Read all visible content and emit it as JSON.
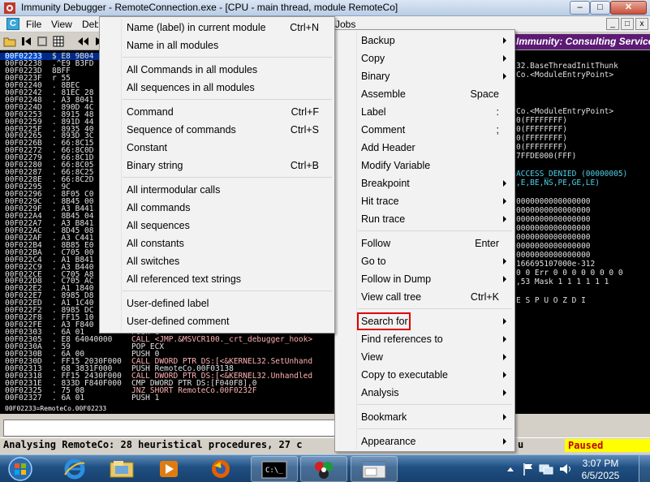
{
  "window": {
    "title": "Immunity Debugger - RemoteConnection.exe - [CPU - main thread, module RemoteCo]",
    "caption_min": "–",
    "caption_max": "□",
    "caption_close": "✕"
  },
  "menubar": {
    "icon_letter": "C",
    "items": [
      "File",
      "View",
      "Debug",
      "Jobs"
    ],
    "mdi_min": "_",
    "mdi_restore": "□",
    "mdi_close": "x"
  },
  "banner": "Immunity: Consulting Services Ma",
  "cpu": {
    "rows": [
      {
        "addr": "00F02233",
        "hex": "$ E8 9B04",
        "asm": "",
        "sel": true
      },
      {
        "addr": "00F02238",
        "hex": ".^E9 B3FD",
        "asm": ""
      },
      {
        "addr": "00F0223D",
        "hex": "  8BFF",
        "asm": ""
      },
      {
        "addr": "00F0223F",
        "hex": "r 55",
        "asm": ""
      },
      {
        "addr": "00F02240",
        "hex": ". 8BEC",
        "asm": ""
      },
      {
        "addr": "00F02242",
        "hex": ". 81EC 28",
        "asm": ""
      },
      {
        "addr": "00F02248",
        "hex": ". A3 8041",
        "asm": ""
      },
      {
        "addr": "00F0224D",
        "hex": ". 890D 4C",
        "asm": ""
      },
      {
        "addr": "00F02253",
        "hex": ". 8915 48",
        "asm": ""
      },
      {
        "addr": "00F02259",
        "hex": ". 891D 44",
        "asm": ""
      },
      {
        "addr": "00F0225F",
        "hex": ". 8935 40",
        "asm": ""
      },
      {
        "addr": "00F02265",
        "hex": ". 893D 3C",
        "asm": ""
      },
      {
        "addr": "00F0226B",
        "hex": ". 66:8C15",
        "asm": ""
      },
      {
        "addr": "00F02272",
        "hex": ". 66:8C0D",
        "asm": ""
      },
      {
        "addr": "00F02279",
        "hex": ". 66:8C1D",
        "asm": ""
      },
      {
        "addr": "00F02280",
        "hex": ". 66:8C05",
        "asm": ""
      },
      {
        "addr": "00F02287",
        "hex": ". 66:8C25",
        "asm": ""
      },
      {
        "addr": "00F0228E",
        "hex": ". 66:8C2D",
        "asm": ""
      },
      {
        "addr": "00F02295",
        "hex": ". 9C",
        "asm": ""
      },
      {
        "addr": "00F02296",
        "hex": ". 8F05 C0",
        "asm": ""
      },
      {
        "addr": "00F0229C",
        "hex": ". 8B45 00",
        "asm": ""
      },
      {
        "addr": "00F0229F",
        "hex": ". A3 B441",
        "asm": ""
      },
      {
        "addr": "00F022A4",
        "hex": ". 8B45 04",
        "asm": ""
      },
      {
        "addr": "00F022A7",
        "hex": ". A3 B841",
        "asm": ""
      },
      {
        "addr": "00F022AC",
        "hex": ". 8D45 08",
        "asm": ""
      },
      {
        "addr": "00F022AF",
        "hex": ". A3 C441",
        "asm": ""
      },
      {
        "addr": "00F022B4",
        "hex": ". 8B85 E0",
        "asm": ""
      },
      {
        "addr": "00F022BA",
        "hex": ". C705 00",
        "asm": ""
      },
      {
        "addr": "00F022C4",
        "hex": ". A1 B841",
        "asm": ""
      },
      {
        "addr": "00F022C9",
        "hex": ". A3 B440",
        "asm": ""
      },
      {
        "addr": "00F022CE",
        "hex": ". C705 A8",
        "asm": ""
      },
      {
        "addr": "00F022D8",
        "hex": ". C705 AC",
        "asm": ""
      },
      {
        "addr": "00F022E2",
        "hex": ". A1 1840",
        "asm": ""
      },
      {
        "addr": "00F022E7",
        "hex": ". 8985 D8",
        "asm": ""
      },
      {
        "addr": "00F022ED",
        "hex": ". A1 1C40",
        "asm": ""
      },
      {
        "addr": "00F022F2",
        "hex": ". 8985 DC",
        "asm": ""
      },
      {
        "addr": "00F022F8",
        "hex": ". FF15 10",
        "asm": ""
      },
      {
        "addr": "00F022FE",
        "hex": ". A3 F840",
        "asm": ""
      },
      {
        "addr": "00F02303",
        "hex": ". 6A 01",
        "asm": "PUSH 1"
      },
      {
        "addr": "00F02305",
        "hex": ". E8 64040000",
        "asm": "CALL <JMP.&MSVCR100._crt_debugger_hook>",
        "call": true
      },
      {
        "addr": "00F0230A",
        "hex": ". 59",
        "asm": "POP ECX"
      },
      {
        "addr": "00F0230B",
        "hex": ". 6A 00",
        "asm": "PUSH 0"
      },
      {
        "addr": "00F0230D",
        "hex": ". FF15 2030F000",
        "asm": "CALL DWORD PTR DS:[<&KERNEL32.SetUnhand",
        "call": true
      },
      {
        "addr": "00F02313",
        "hex": ". 68 3831F000",
        "asm": "PUSH RemoteCo.00F03138"
      },
      {
        "addr": "00F02318",
        "hex": ". FF15 2430F000",
        "asm": "CALL DWORD PTR DS:[<&KERNEL32.Unhandled",
        "call": true
      },
      {
        "addr": "00F0231E",
        "hex": ". 833D F840F000",
        "asm": "CMP DWORD PTR DS:[F040F8],0"
      },
      {
        "addr": "00F02325",
        "hex": ". 75 08",
        "asm": "JNZ SHORT RemoteCo.00F0232F",
        "jnz": true
      },
      {
        "addr": "00F02327",
        "hex": ". 6A 01",
        "asm": "PUSH 1"
      }
    ],
    "status_line": "00F02233=RemoteCo.00F02233"
  },
  "registers": [
    {
      "text": "32.BaseThreadInitThunk",
      "cyan": false
    },
    {
      "text": "Co.<ModuleEntryPoint>",
      "cyan": false
    },
    {
      "text": "",
      "cyan": false
    },
    {
      "text": "",
      "cyan": false
    },
    {
      "text": "",
      "cyan": false
    },
    {
      "text": "Co.<ModuleEntryPoint>",
      "cyan": false
    },
    {
      "text": "0(FFFFFFFF)",
      "cyan": false
    },
    {
      "text": "0(FFFFFFFF)",
      "cyan": false
    },
    {
      "text": "0(FFFFFFFF)",
      "cyan": false
    },
    {
      "text": "0(FFFFFFFF)",
      "cyan": false
    },
    {
      "text": "7FFDE000(FFF)",
      "cyan": false
    },
    {
      "text": "",
      "cyan": false
    },
    {
      "text": "ACCESS_DENIED (00000005)",
      "cyan": true
    },
    {
      "text": ",E,BE,NS,PE,GE,LE)",
      "cyan": true
    },
    {
      "text": "",
      "cyan": false
    },
    {
      "text": "0000000000000000",
      "cyan": false
    },
    {
      "text": "0000000000000000",
      "cyan": false
    },
    {
      "text": "0000000000000000",
      "cyan": false
    },
    {
      "text": "0000000000000000",
      "cyan": false
    },
    {
      "text": "0000000000000000",
      "cyan": false
    },
    {
      "text": "0000000000000000",
      "cyan": false
    },
    {
      "text": "0000000000000000",
      "cyan": false
    },
    {
      "text": "166695107000e-312",
      "cyan": false
    },
    {
      "text": "0 0  Err 0 0 0 0 0 0 0 0",
      "cyan": false
    },
    {
      "text": ",53  Mask   1 1 1 1 1 1",
      "cyan": false
    },
    {
      "text": "",
      "cyan": false
    },
    {
      "text": "E S P U O Z D I",
      "cyan": false
    }
  ],
  "statusbar": {
    "text": "Analysing RemoteCo: 28 heuristical procedures, 27 c",
    "tail": "u",
    "state": "Paused"
  },
  "menu_search": {
    "items": [
      {
        "label": "Name (label) in current module",
        "shortcut": "Ctrl+N"
      },
      {
        "label": "Name in all modules",
        "shortcut": ""
      },
      {
        "sep": true
      },
      {
        "label": "All Commands in all modules",
        "shortcut": ""
      },
      {
        "label": "All sequences in all modules",
        "shortcut": ""
      },
      {
        "sep": true
      },
      {
        "label": "Command",
        "shortcut": "Ctrl+F"
      },
      {
        "label": "Sequence of commands",
        "shortcut": "Ctrl+S"
      },
      {
        "label": "Constant",
        "shortcut": ""
      },
      {
        "label": "Binary string",
        "shortcut": "Ctrl+B"
      },
      {
        "sep": true
      },
      {
        "label": "All intermodular calls",
        "shortcut": ""
      },
      {
        "label": "All commands",
        "shortcut": ""
      },
      {
        "label": "All sequences",
        "shortcut": ""
      },
      {
        "label": "All constants",
        "shortcut": ""
      },
      {
        "label": "All switches",
        "shortcut": ""
      },
      {
        "label": "All referenced text strings",
        "shortcut": ""
      },
      {
        "sep": true
      },
      {
        "label": "User-defined label",
        "shortcut": ""
      },
      {
        "label": "User-defined comment",
        "shortcut": ""
      }
    ]
  },
  "menu_main": {
    "items": [
      {
        "label": "Backup",
        "shortcut": "",
        "sub": true
      },
      {
        "label": "Copy",
        "shortcut": "",
        "sub": true
      },
      {
        "label": "Binary",
        "shortcut": "",
        "sub": true
      },
      {
        "label": "Assemble",
        "shortcut": "Space",
        "sub": false
      },
      {
        "label": "Label",
        "shortcut": ":",
        "sub": false
      },
      {
        "label": "Comment",
        "shortcut": ";",
        "sub": false
      },
      {
        "label": "Add Header",
        "shortcut": "",
        "sub": false
      },
      {
        "label": "Modify Variable",
        "shortcut": "",
        "sub": false
      },
      {
        "label": "Breakpoint",
        "shortcut": "",
        "sub": true
      },
      {
        "label": "Hit trace",
        "shortcut": "",
        "sub": true
      },
      {
        "label": "Run trace",
        "shortcut": "",
        "sub": true
      },
      {
        "sep": true
      },
      {
        "label": "Follow",
        "shortcut": "Enter",
        "sub": false
      },
      {
        "label": "Go to",
        "shortcut": "",
        "sub": true
      },
      {
        "label": "Follow in Dump",
        "shortcut": "",
        "sub": true
      },
      {
        "label": "View call tree",
        "shortcut": "Ctrl+K",
        "sub": false
      },
      {
        "sep": true
      },
      {
        "label": "Search for",
        "shortcut": "",
        "sub": true,
        "highlight": true
      },
      {
        "label": "Find references to",
        "shortcut": "",
        "sub": true
      },
      {
        "label": "View",
        "shortcut": "",
        "sub": true
      },
      {
        "label": "Copy to executable",
        "shortcut": "",
        "sub": true
      },
      {
        "label": "Analysis",
        "shortcut": "",
        "sub": true
      },
      {
        "sep": true
      },
      {
        "label": "Bookmark",
        "shortcut": "",
        "sub": true
      },
      {
        "sep": true
      },
      {
        "label": "Appearance",
        "shortcut": "",
        "sub": true
      }
    ]
  },
  "taskbar": {
    "apps": [
      "start-orb",
      "internet-explorer",
      "windows-explorer",
      "media-player",
      "firefox",
      "command-prompt",
      "immunity-debugger",
      "app-window"
    ],
    "time": "3:07 PM",
    "date": "6/5/2025"
  }
}
